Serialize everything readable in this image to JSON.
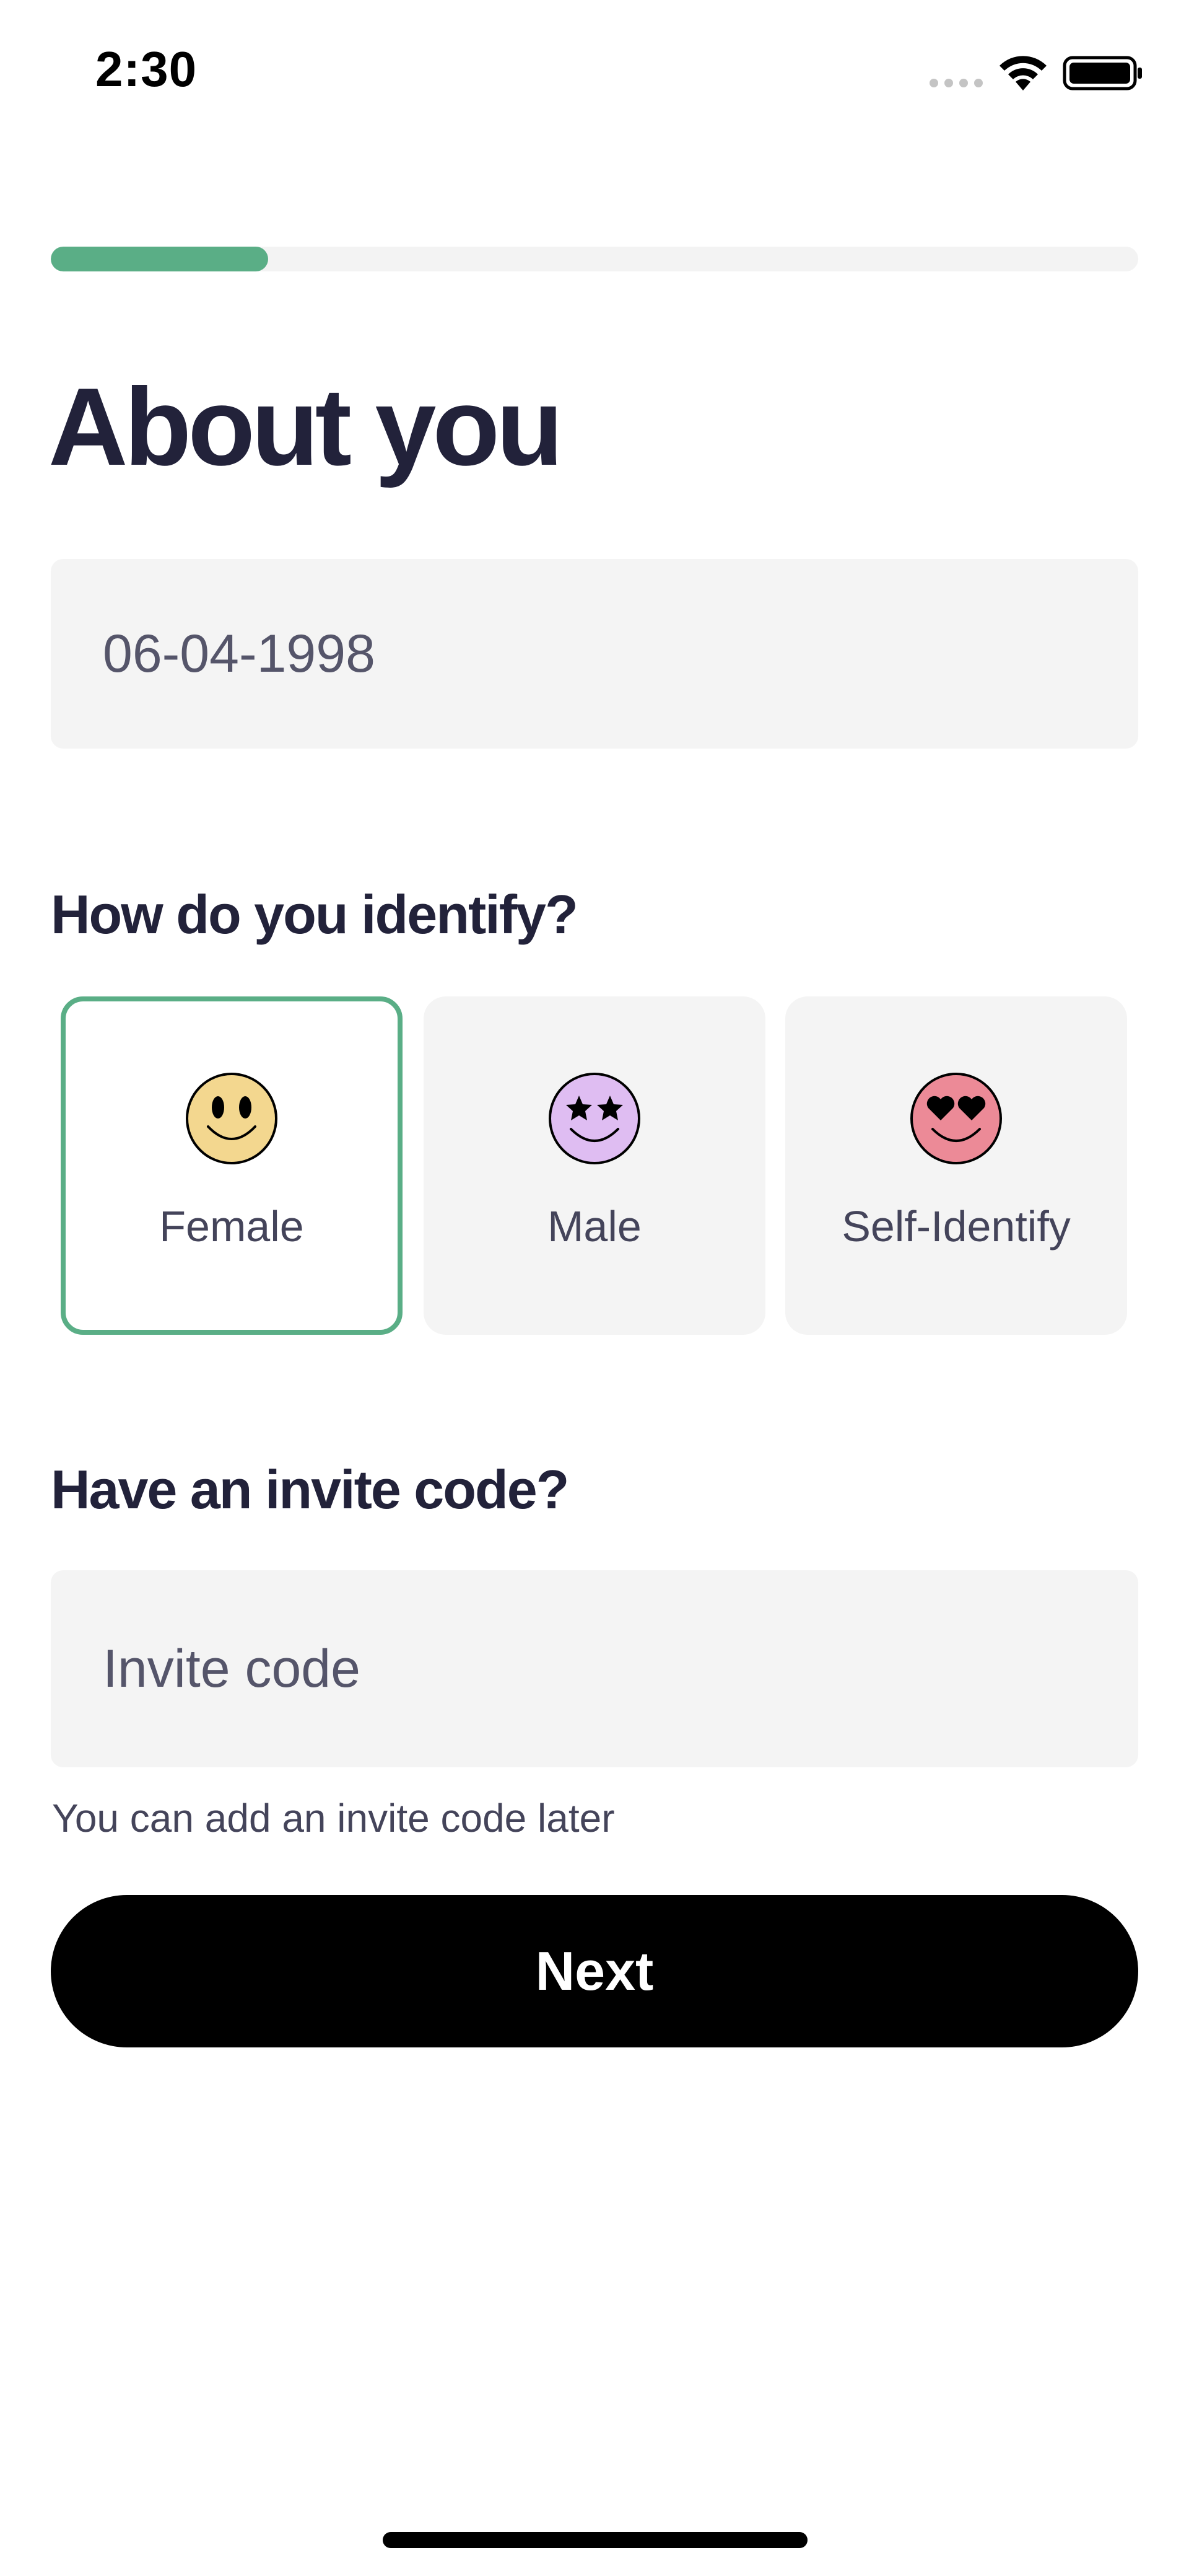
{
  "status_bar": {
    "time": "2:30",
    "icons": [
      "cellular-signal-icon",
      "wifi-icon",
      "battery-icon"
    ]
  },
  "progress": {
    "value": 0.2,
    "fill_color": "#5aae86",
    "track_color": "#f3f3f3"
  },
  "page": {
    "title": "About you"
  },
  "dob": {
    "value": "06-04-1998"
  },
  "identify": {
    "heading": "How do you identify?",
    "selected": "Female",
    "options": [
      {
        "label": "Female",
        "icon": "smiley-face-icon",
        "color": "#f3d78f",
        "selected": true
      },
      {
        "label": "Male",
        "icon": "star-eyes-face-icon",
        "color": "#dfbdf2",
        "selected": false
      },
      {
        "label": "Self-Identify",
        "icon": "heart-eyes-face-icon",
        "color": "#ec8a97",
        "selected": false
      }
    ]
  },
  "invite": {
    "heading": "Have an invite code?",
    "placeholder": "Invite code",
    "helper": "You can add an invite code later"
  },
  "actions": {
    "next_label": "Next"
  },
  "colors": {
    "accent": "#5aae86",
    "text_dark": "#22223a",
    "field_bg": "#f4f4f4",
    "button_bg": "#000000"
  }
}
